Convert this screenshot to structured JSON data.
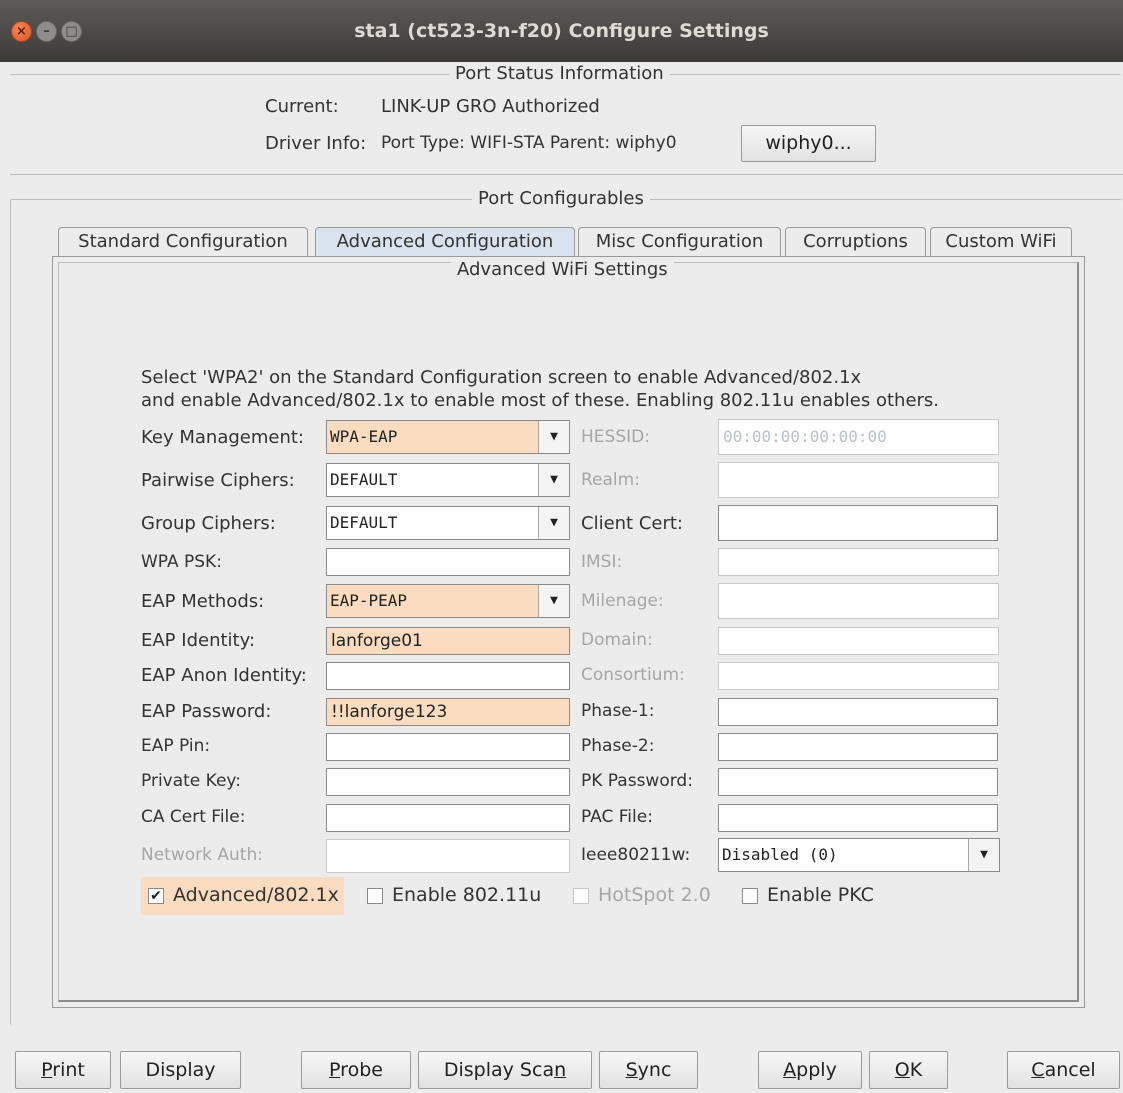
{
  "window": {
    "title": "sta1  (ct523-3n-f20) Configure Settings",
    "close_glyph": "×",
    "min_glyph": "–",
    "max_glyph": "□"
  },
  "port_status": {
    "legend": "Port Status Information",
    "current_label": "Current:",
    "current_value": "LINK-UP GRO  Authorized",
    "driver_label": "Driver Info:",
    "driver_value": "Port Type: WIFI-STA   Parent: wiphy0",
    "wiphy_button": "wiphy0..."
  },
  "port_configurables": {
    "legend": "Port Configurables"
  },
  "tabs": [
    {
      "label": "Standard Configuration"
    },
    {
      "label": "Advanced Configuration"
    },
    {
      "label": "Misc Configuration"
    },
    {
      "label": "Corruptions"
    },
    {
      "label": "Custom WiFi"
    }
  ],
  "advanced": {
    "legend": "Advanced WiFi Settings",
    "note_line1": "Select 'WPA2' on the Standard Configuration screen to enable Advanced/802.1x",
    "note_line2": "and enable Advanced/802.1x to enable most of these. Enabling 802.11u enables others.",
    "left": {
      "key_mgmt_label": "Key Management:",
      "key_mgmt_value": "WPA-EAP",
      "pairwise_label": "Pairwise Ciphers:",
      "pairwise_value": "DEFAULT",
      "group_label": "Group Ciphers:",
      "group_value": "DEFAULT",
      "psk_label": "WPA PSK:",
      "psk_value": "",
      "eap_methods_label": "EAP Methods:",
      "eap_methods_value": "EAP-PEAP",
      "eap_identity_label": "EAP Identity:",
      "eap_identity_value": "lanforge01",
      "eap_anon_label": "EAP Anon Identity:",
      "eap_anon_value": "",
      "eap_password_label": "EAP Password:",
      "eap_password_value": "!!lanforge123",
      "eap_pin_label": "EAP Pin:",
      "eap_pin_value": "",
      "private_key_label": "Private Key:",
      "private_key_value": "",
      "ca_cert_label": "CA Cert File:",
      "ca_cert_value": "",
      "network_auth_label": "Network Auth:",
      "network_auth_value": ""
    },
    "right": {
      "hessid_label": "HESSID:",
      "hessid_value": "00:00:00:00:00:00",
      "realm_label": "Realm:",
      "realm_value": "",
      "client_cert_label": "Client Cert:",
      "client_cert_value": "",
      "imsi_label": "IMSI:",
      "imsi_value": "",
      "milenage_label": "Milenage:",
      "milenage_value": "",
      "domain_label": "Domain:",
      "domain_value": "",
      "consortium_label": "Consortium:",
      "consortium_value": "",
      "phase1_label": "Phase-1:",
      "phase1_value": "",
      "phase2_label": "Phase-2:",
      "phase2_value": "",
      "pk_password_label": "PK Password:",
      "pk_password_value": "",
      "pac_file_label": "PAC File:",
      "pac_file_value": "",
      "ieee80211w_label": "Ieee80211w:",
      "ieee80211w_value": "Disabled (0)"
    },
    "checks": {
      "adv8021x_label": "Advanced/802.1x",
      "adv8021x_checked": "✔",
      "enable80211u_label": "Enable 802.11u",
      "hotspot_label": "HotSpot 2.0",
      "pkc_label": "Enable PKC"
    },
    "dropdown_glyph": "▼"
  },
  "buttons": {
    "print_u": "P",
    "print_rest": "rint",
    "display": "Display",
    "probe_u": "P",
    "probe_rest": "robe",
    "display_scan_pre": "Display Sca",
    "display_scan_u": "n",
    "sync_u": "S",
    "sync_rest": "ync",
    "apply_u": "A",
    "apply_rest": "pply",
    "ok_pre": "",
    "ok_u": "O",
    "ok_rest": "K",
    "cancel_u": "C",
    "cancel_rest": "ancel"
  },
  "colors": {
    "highlight": "#fbdcc0",
    "active_tab": "#d8e3ee",
    "title_bar": "#3c3b37"
  }
}
